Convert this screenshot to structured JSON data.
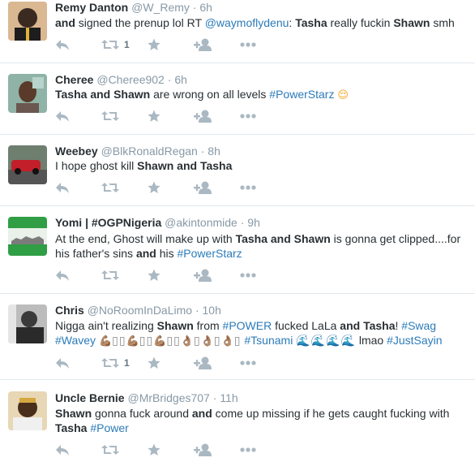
{
  "tweets": [
    {
      "name": "Remy Danton",
      "handle": "@W_Remy",
      "time": "6h",
      "parts": [
        {
          "t": "and",
          "b": true
        },
        {
          "t": " signed the prenup lol RT "
        },
        {
          "t": "@waymoflydenu",
          "link": true
        },
        {
          "t": ": "
        },
        {
          "t": "Tasha",
          "b": true
        },
        {
          "t": " really fuckin "
        },
        {
          "t": "Shawn",
          "b": true
        },
        {
          "t": " smh"
        }
      ],
      "retweet_count": "1"
    },
    {
      "name": "Cheree",
      "handle": "@Cheree902",
      "time": "6h",
      "parts": [
        {
          "t": "Tasha and Shawn",
          "b": true
        },
        {
          "t": " are wrong on all levels "
        },
        {
          "t": "#PowerStarz",
          "link": true
        },
        {
          "t": " "
        },
        {
          "t": "😌",
          "emoji": true
        }
      ],
      "retweet_count": ""
    },
    {
      "name": "Weebey",
      "handle": "@BlkRonaldRegan",
      "time": "8h",
      "parts": [
        {
          "t": "I hope ghost kill "
        },
        {
          "t": "Shawn and Tasha",
          "b": true
        }
      ],
      "retweet_count": ""
    },
    {
      "name": "Yomi | #OGPNigeria",
      "handle": "@akintonmide",
      "time": "9h",
      "parts": [
        {
          "t": "At the end, Ghost will make up with "
        },
        {
          "t": "Tasha and Shawn",
          "b": true
        },
        {
          "t": " is gonna get clipped....for his father's sins "
        },
        {
          "t": "and",
          "b": true
        },
        {
          "t": " his "
        },
        {
          "t": "#PowerStarz",
          "link": true
        }
      ],
      "retweet_count": ""
    },
    {
      "name": "Chris",
      "handle": "@NoRoomInDaLimo",
      "time": "10h",
      "parts": [
        {
          "t": "Nigga ain't realizing "
        },
        {
          "t": "Shawn",
          "b": true
        },
        {
          "t": " from "
        },
        {
          "t": "#POWER",
          "link": true
        },
        {
          "t": " fucked LaLa "
        },
        {
          "t": "and Tasha",
          "b": true
        },
        {
          "t": "! "
        },
        {
          "t": "#Swag",
          "link": true
        },
        {
          "t": " "
        },
        {
          "t": "#Wavey",
          "link": true
        },
        {
          "t": " "
        },
        {
          "t": "💪🏽",
          "emoji": true
        },
        {
          "t": "▯▯",
          "boxes": true
        },
        {
          "t": "💪🏽",
          "emoji": true
        },
        {
          "t": "▯▯",
          "boxes": true
        },
        {
          "t": "💪🏽",
          "emoji": true
        },
        {
          "t": "▯▯",
          "boxes": true
        },
        {
          "t": "👌🏽",
          "emoji": true
        },
        {
          "t": "▯",
          "boxes": true
        },
        {
          "t": "👌🏽",
          "emoji": true
        },
        {
          "t": "▯",
          "boxes": true
        },
        {
          "t": "👌🏽",
          "emoji": true
        },
        {
          "t": "▯",
          "boxes": true
        },
        {
          "t": " "
        },
        {
          "t": "#Tsunami",
          "link": true
        },
        {
          "t": " "
        },
        {
          "t": "🌊🌊🌊🌊",
          "wave": true
        },
        {
          "t": " lmao "
        },
        {
          "t": "#JustSayin",
          "link": true
        }
      ],
      "retweet_count": "1"
    },
    {
      "name": "Uncle Bernie",
      "handle": "@MrBridges707",
      "time": "11h",
      "parts": [
        {
          "t": "Shawn",
          "b": true
        },
        {
          "t": " gonna fuck around "
        },
        {
          "t": "and",
          "b": true
        },
        {
          "t": " come up missing if he gets caught fucking with "
        },
        {
          "t": "Tasha",
          "b": true
        },
        {
          "t": " "
        },
        {
          "t": "#Power",
          "link": true
        }
      ],
      "retweet_count": ""
    }
  ],
  "icons": [
    "reply-icon",
    "retweet-icon",
    "favorite-icon",
    "follow-icon",
    "more-icon"
  ],
  "colors": {
    "link": "#2b7bb9",
    "muted": "#8899a6",
    "icon": "#aab8c2",
    "text": "#292f33",
    "divider": "#e1e8ed"
  }
}
